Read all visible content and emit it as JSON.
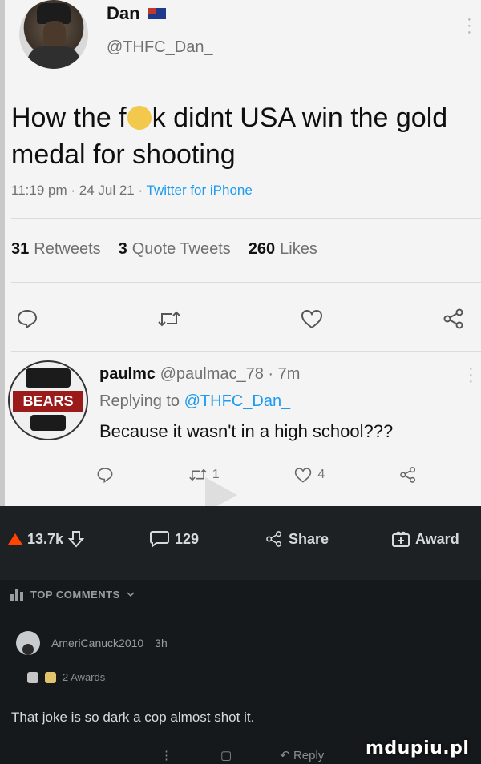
{
  "tweet": {
    "display_name": "Dan",
    "handle": "@THFC_Dan_",
    "text_part1": "How the f",
    "text_part2": "k didnt USA win the gold medal for shooting",
    "time": "11:19 pm",
    "date": "24 Jul 21",
    "source": "Twitter for iPhone",
    "stats": {
      "retweets_count": "31",
      "retweets_label": "Retweets",
      "quotes_count": "3",
      "quotes_label": "Quote Tweets",
      "likes_count": "260",
      "likes_label": "Likes"
    }
  },
  "reply": {
    "name": "paulmc",
    "handle": "@paulmac_78",
    "age": "7m",
    "replying_label": "Replying to",
    "replying_handle": "@THFC_Dan_",
    "text": "Because it wasn't in a high school???",
    "avatar_text": "BEARS",
    "retweets": "1",
    "likes": "4"
  },
  "reddit": {
    "votes": "13.7k",
    "comments": "129",
    "share_label": "Share",
    "award_label": "Award",
    "top_comments_label": "TOP COMMENTS",
    "comment_user": "AmeriCanuck2010",
    "comment_age": "3h",
    "awards_label": "2 Awards",
    "comment_text": "That joke is so dark a cop almost shot it.",
    "reply_label": "Reply"
  },
  "watermark": "mdupiu.pl",
  "colors": {
    "twitter_blue": "#1d9bf0",
    "reddit_orange": "#ff4500",
    "dark_bg": "#16191c"
  }
}
